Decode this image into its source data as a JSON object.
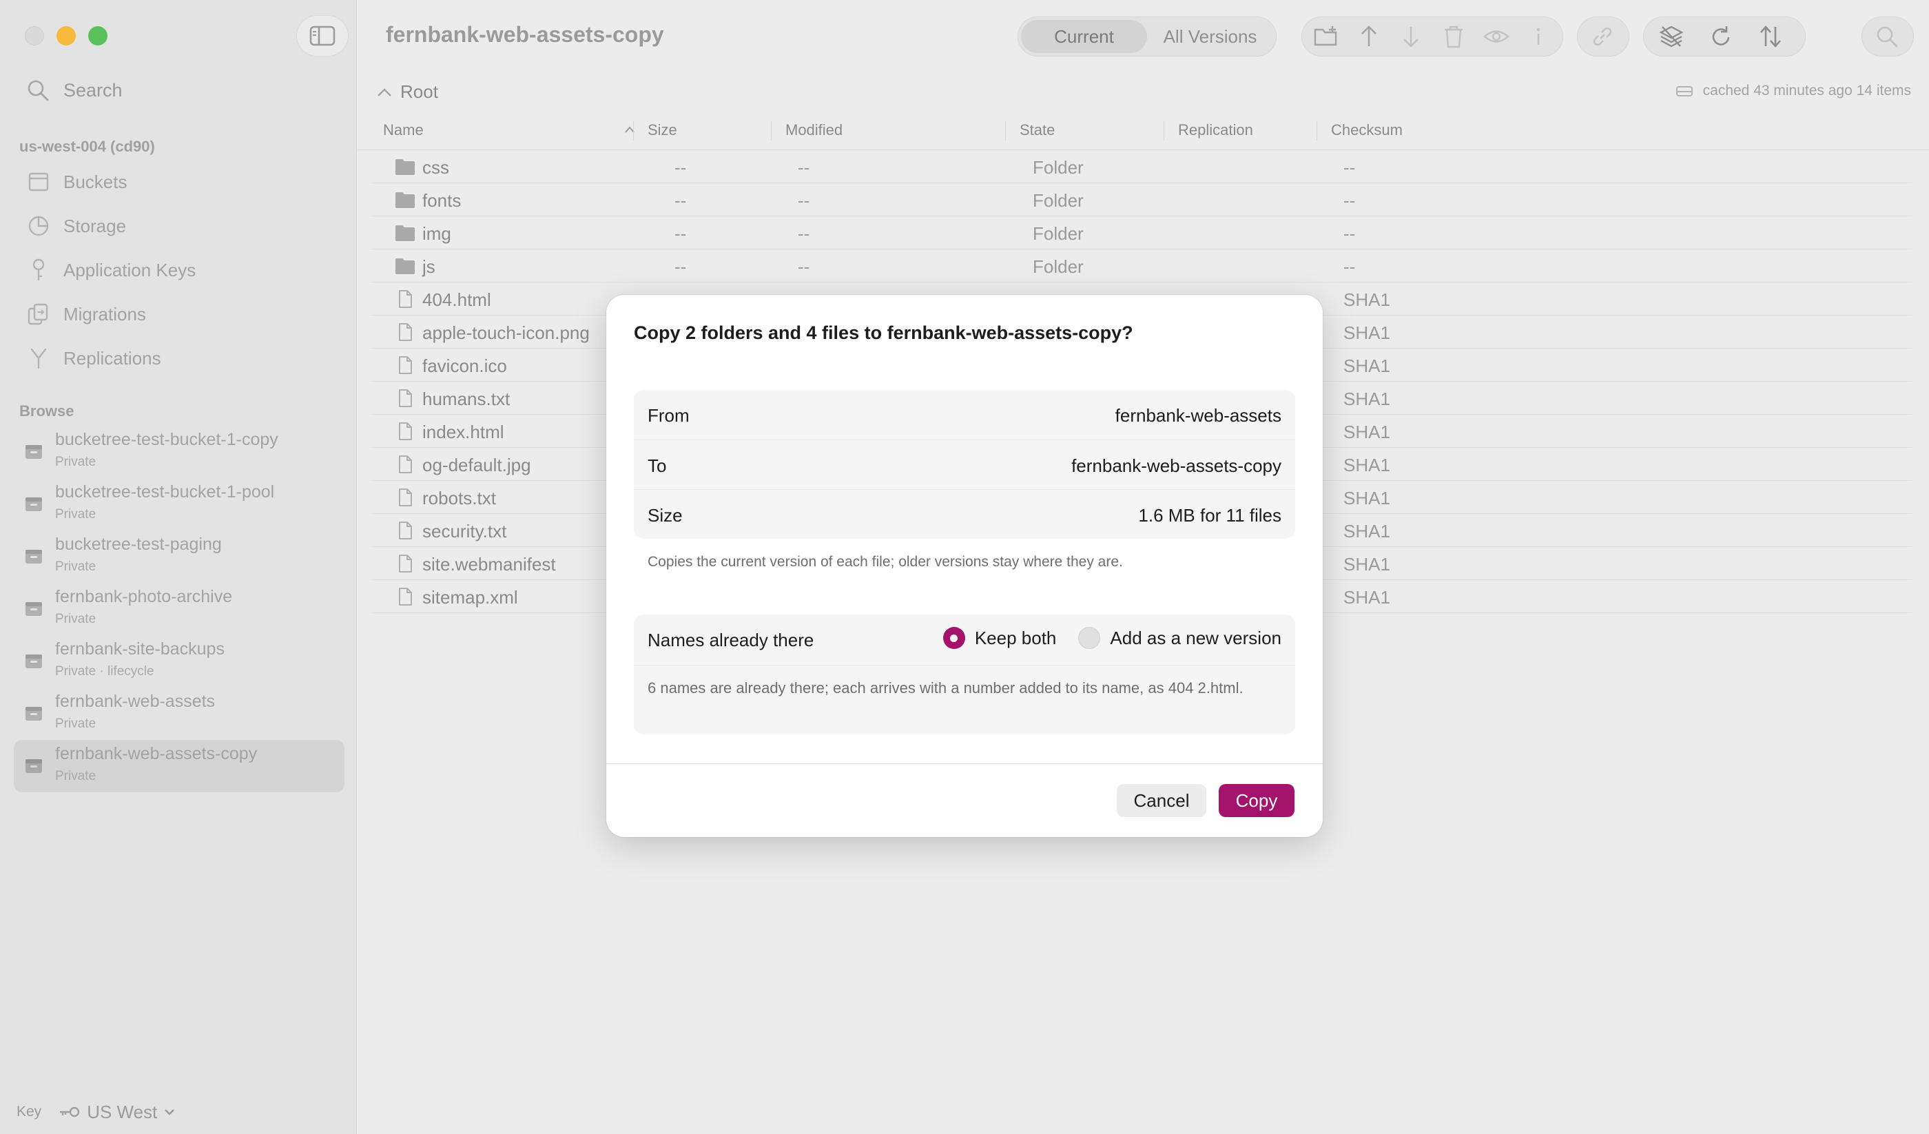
{
  "window": {
    "title": "fernbank-web-assets-copy"
  },
  "colors": {
    "accent": "#a3136b",
    "sidebar_bg": "#e3e3e3",
    "main_bg": "#ececec"
  },
  "sidebar": {
    "search_placeholder": "Search",
    "account_label": "us-west-004 (cd90)",
    "nav": [
      {
        "label": "Buckets",
        "icon": "bucket-icon"
      },
      {
        "label": "Storage",
        "icon": "pie-chart-icon"
      },
      {
        "label": "Application Keys",
        "icon": "key-icon"
      },
      {
        "label": "Migrations",
        "icon": "migration-icon"
      },
      {
        "label": "Replications",
        "icon": "branch-icon"
      }
    ],
    "browse_label": "Browse",
    "buckets": [
      {
        "name": "bucketree-test-bucket-1-copy",
        "sub": "Private"
      },
      {
        "name": "bucketree-test-bucket-1-pool",
        "sub": "Private"
      },
      {
        "name": "bucketree-test-paging",
        "sub": "Private"
      },
      {
        "name": "fernbank-photo-archive",
        "sub": "Private"
      },
      {
        "name": "fernbank-site-backups",
        "sub": "Private · lifecycle"
      },
      {
        "name": "fernbank-web-assets",
        "sub": "Private"
      },
      {
        "name": "fernbank-web-assets-copy",
        "sub": "Private"
      }
    ],
    "selected_bucket_index": 6,
    "footer": {
      "key_label": "Key",
      "region": "US West"
    }
  },
  "toolbar": {
    "segments": [
      "Current",
      "All Versions"
    ],
    "active_segment": "Current",
    "icons": [
      "new-folder-icon",
      "upload-icon",
      "download-icon",
      "trash-icon",
      "eye-icon",
      "info-icon",
      "link-icon",
      "layers-icon",
      "refresh-icon",
      "sort-icon",
      "search-icon"
    ]
  },
  "pathbar": {
    "crumb": "Root",
    "cache_info": "cached 43 minutes ago  14 items"
  },
  "table": {
    "columns": [
      "Name",
      "Size",
      "Modified",
      "State",
      "Replication",
      "Checksum"
    ],
    "rows": [
      {
        "name": "css",
        "type": "folder",
        "size": "--",
        "modified": "--",
        "state": "Folder",
        "replication": "",
        "checksum": "--"
      },
      {
        "name": "fonts",
        "type": "folder",
        "size": "--",
        "modified": "--",
        "state": "Folder",
        "replication": "",
        "checksum": "--"
      },
      {
        "name": "img",
        "type": "folder",
        "size": "--",
        "modified": "--",
        "state": "Folder",
        "replication": "",
        "checksum": "--"
      },
      {
        "name": "js",
        "type": "folder",
        "size": "--",
        "modified": "--",
        "state": "Folder",
        "replication": "",
        "checksum": "--"
      },
      {
        "name": "404.html",
        "type": "file",
        "size": "",
        "modified": "",
        "state": "",
        "replication": "",
        "checksum": "SHA1"
      },
      {
        "name": "apple-touch-icon.png",
        "type": "file",
        "size": "",
        "modified": "",
        "state": "",
        "replication": "",
        "checksum": "SHA1"
      },
      {
        "name": "favicon.ico",
        "type": "file",
        "size": "",
        "modified": "",
        "state": "",
        "replication": "",
        "checksum": "SHA1"
      },
      {
        "name": "humans.txt",
        "type": "file",
        "size": "",
        "modified": "",
        "state": "",
        "replication": "",
        "checksum": "SHA1"
      },
      {
        "name": "index.html",
        "type": "file",
        "size": "",
        "modified": "",
        "state": "",
        "replication": "",
        "checksum": "SHA1"
      },
      {
        "name": "og-default.jpg",
        "type": "file",
        "size": "",
        "modified": "",
        "state": "",
        "replication": "",
        "checksum": "SHA1"
      },
      {
        "name": "robots.txt",
        "type": "file",
        "size": "",
        "modified": "",
        "state": "",
        "replication": "",
        "checksum": "SHA1"
      },
      {
        "name": "security.txt",
        "type": "file",
        "size": "",
        "modified": "",
        "state": "",
        "replication": "",
        "checksum": "SHA1"
      },
      {
        "name": "site.webmanifest",
        "type": "file",
        "size": "",
        "modified": "",
        "state": "",
        "replication": "",
        "checksum": "SHA1"
      },
      {
        "name": "sitemap.xml",
        "type": "file",
        "size": "",
        "modified": "",
        "state": "",
        "replication": "",
        "checksum": "SHA1"
      }
    ]
  },
  "modal": {
    "title": "Copy 2 folders and 4 files to fernbank-web-assets-copy?",
    "info": [
      {
        "label": "From",
        "value": "fernbank-web-assets"
      },
      {
        "label": "To",
        "value": "fernbank-web-assets-copy"
      },
      {
        "label": "Size",
        "value": "1.6 MB for 11 files"
      }
    ],
    "note": "Copies the current version of each file; older versions stay where they are.",
    "conflict": {
      "label": "Names already there",
      "options": [
        "Keep both",
        "Add as a new version"
      ],
      "selected": "Keep both",
      "note": "6 names are already there; each arrives with a number added to its name, as 404 2.html."
    },
    "cancel_label": "Cancel",
    "confirm_label": "Copy"
  }
}
